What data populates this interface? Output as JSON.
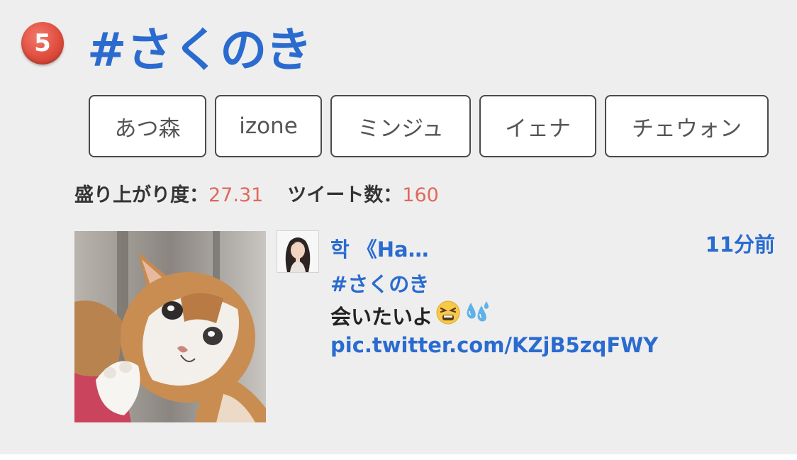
{
  "trend": {
    "rank": "5",
    "title": "#さくのき"
  },
  "tags": [
    "あつ森",
    "izone",
    "ミンジュ",
    "イェナ",
    "チェウォン"
  ],
  "stats": {
    "excitement_label": "盛り上がり度：",
    "excitement_value": "27.31",
    "tweets_label": "ツイート数：",
    "tweets_value": "160"
  },
  "tweet": {
    "user_name": "학 《Ha…",
    "time": "11分前",
    "hashtag": "#さくのき",
    "text": "会いたいよ",
    "emojis": [
      "tired-face-emoji",
      "sweat-droplets-emoji"
    ],
    "link": "pic.twitter.com/KZjB5zqFWY",
    "image": "cat-photo",
    "avatar": "user-avatar-photo"
  },
  "colors": {
    "accent": "#2a6bd0",
    "value": "#e0685c",
    "badge": "#dd4a3b",
    "background": "#eeeeee"
  }
}
